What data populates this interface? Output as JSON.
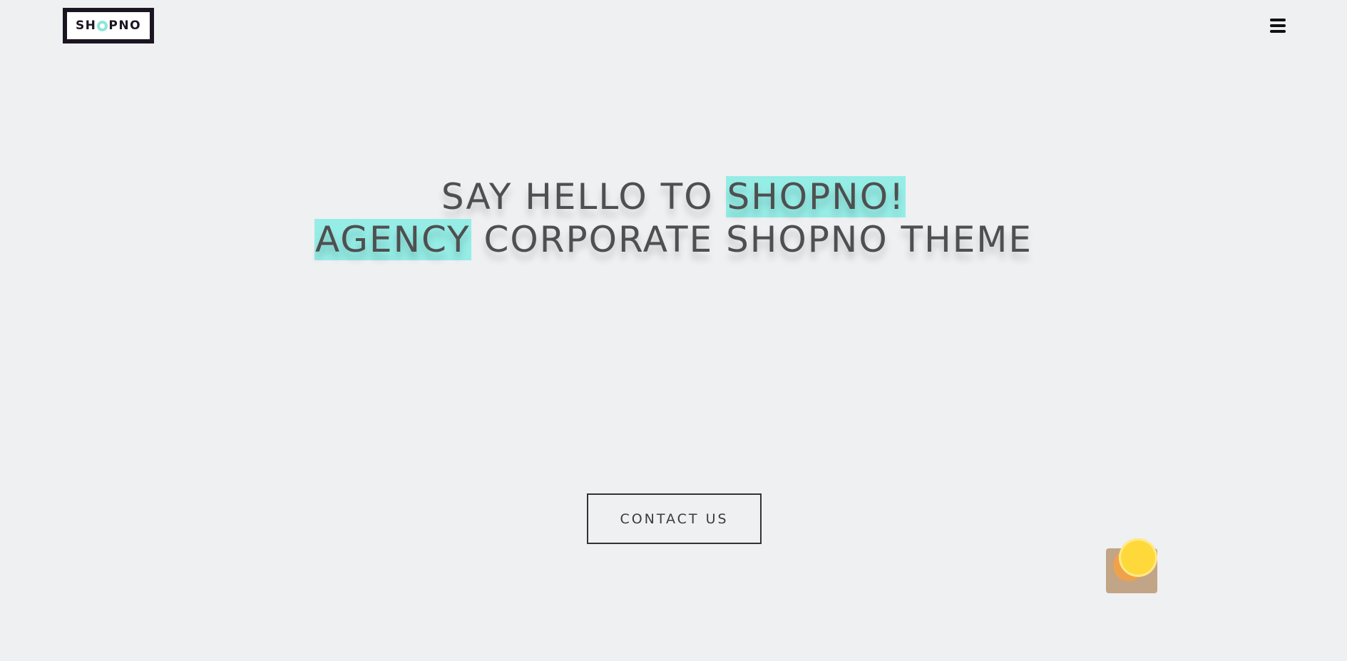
{
  "header": {
    "logo_text_left": "SH",
    "logo_text_o": "O",
    "logo_text_right": "PNO",
    "menu_icon": "hamburger-icon"
  },
  "hero": {
    "line1_plain": "SAY HELLO TO ",
    "line1_highlight": "SHOPNO!",
    "line2_highlight": "AGENCY",
    "line2_plain": " CORPORATE SHOPNO THEME"
  },
  "cta": {
    "contact_label": "CONTACT US"
  },
  "colors": {
    "background": "#eff0f2",
    "highlight": "#95ede6",
    "logo_frame": "#1b1522",
    "heading_text": "#4f4f4f"
  },
  "decoration": {
    "icon": "coin-box-icon"
  }
}
